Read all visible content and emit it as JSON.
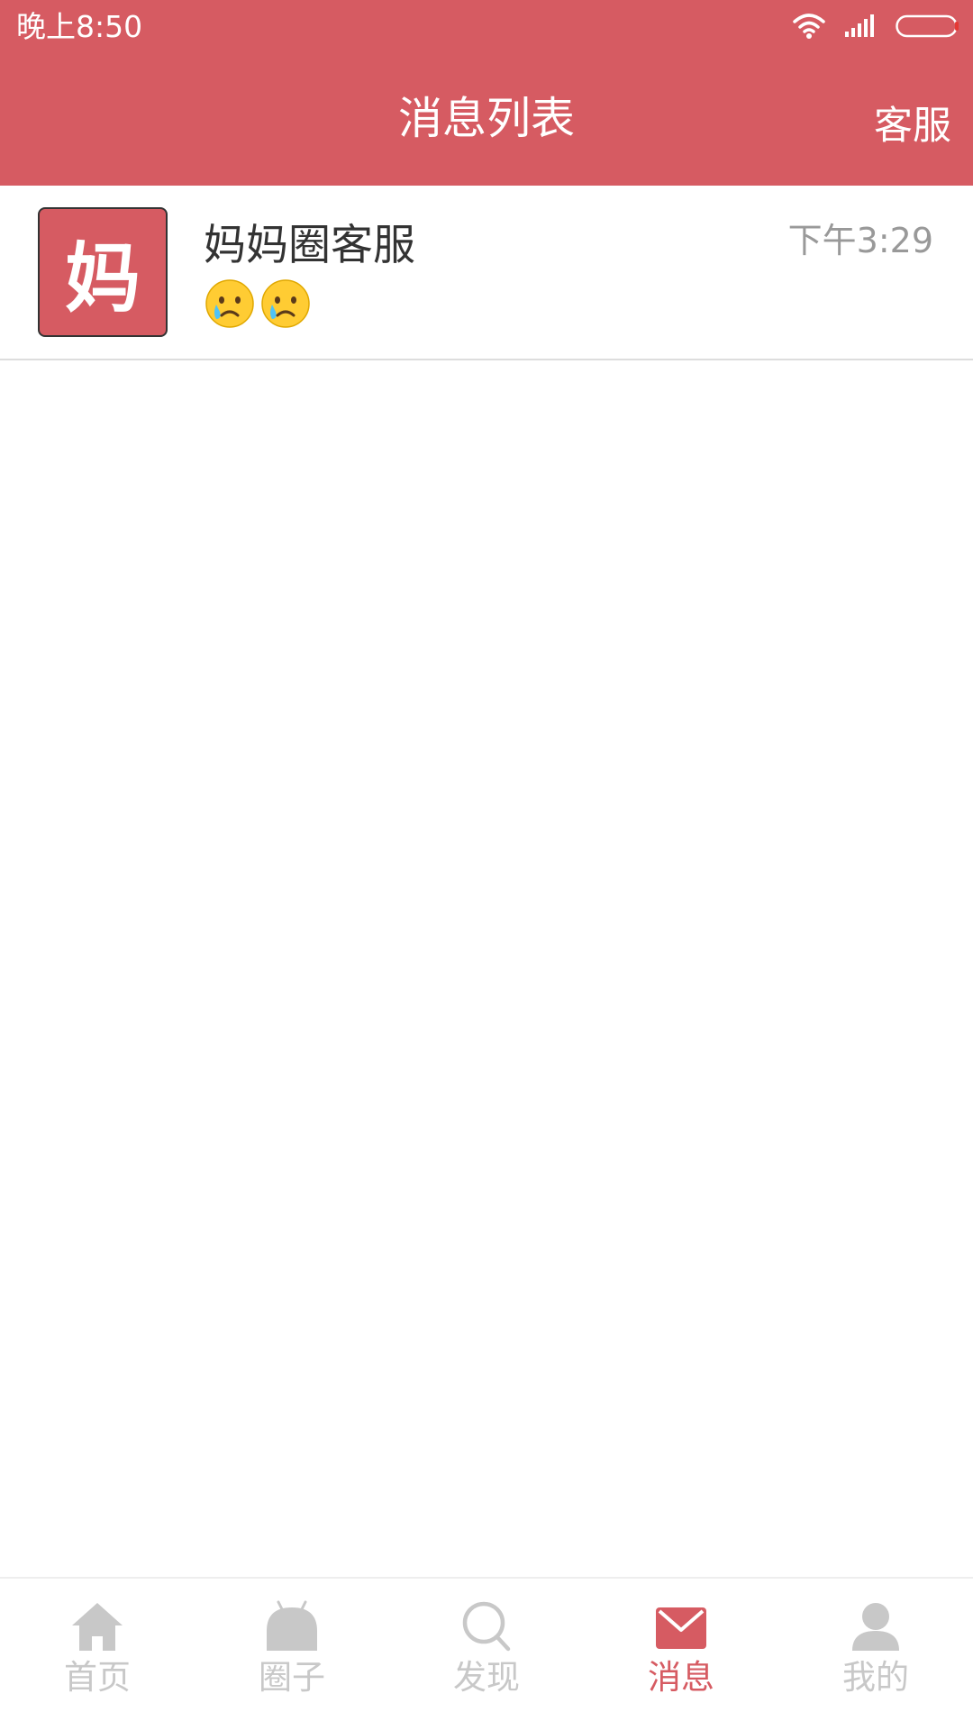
{
  "colors": {
    "brand": "#D65B62",
    "inactive_nav": "#C8C8C8",
    "text_primary": "#333333",
    "text_secondary": "#999999",
    "divider": "#DDDDDD"
  },
  "status_bar": {
    "time": "晚上8:50",
    "icons": [
      "wifi-icon",
      "signal-icon",
      "battery-icon"
    ]
  },
  "header": {
    "title": "消息列表",
    "right_action": "客服"
  },
  "messages": [
    {
      "avatar_text": "妈",
      "name": "妈妈圈客服",
      "time": "下午3:29",
      "preview_icons": [
        "crying-face-emoji",
        "crying-face-emoji"
      ]
    }
  ],
  "bottom_nav": {
    "active_index": 3,
    "items": [
      {
        "label": "首页",
        "icon": "home-icon"
      },
      {
        "label": "圈子",
        "icon": "circle-icon"
      },
      {
        "label": "发现",
        "icon": "discover-search-icon"
      },
      {
        "label": "消息",
        "icon": "mail-icon"
      },
      {
        "label": "我的",
        "icon": "profile-icon"
      }
    ]
  }
}
